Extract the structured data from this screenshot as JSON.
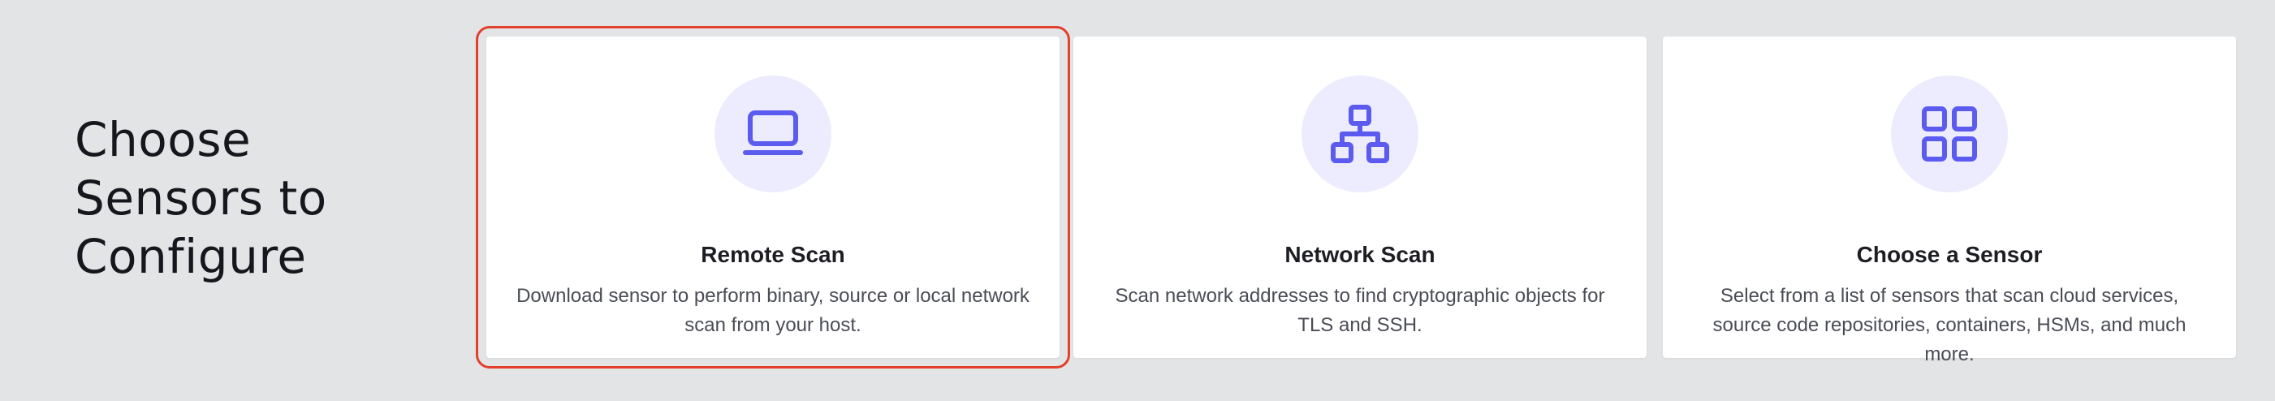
{
  "heading": {
    "line1": "Choose",
    "line2": "Sensors to",
    "line3": "Configure"
  },
  "colors": {
    "accent": "#5b5bf0",
    "icon_bg": "#ececfe",
    "selected_outline": "#e2402c",
    "page_bg": "#e3e4e6"
  },
  "cards": [
    {
      "icon": "laptop-icon",
      "title": "Remote Scan",
      "description": "Download sensor to perform binary, source or local network scan from your host.",
      "selected": true
    },
    {
      "icon": "network-icon",
      "title": "Network Scan",
      "description": "Scan network addresses to find cryptographic objects for TLS and SSH.",
      "selected": false
    },
    {
      "icon": "grid-icon",
      "title": "Choose a Sensor",
      "description": "Select from a list of sensors that scan cloud services, source code repositories, containers, HSMs, and much more.",
      "selected": false
    }
  ]
}
